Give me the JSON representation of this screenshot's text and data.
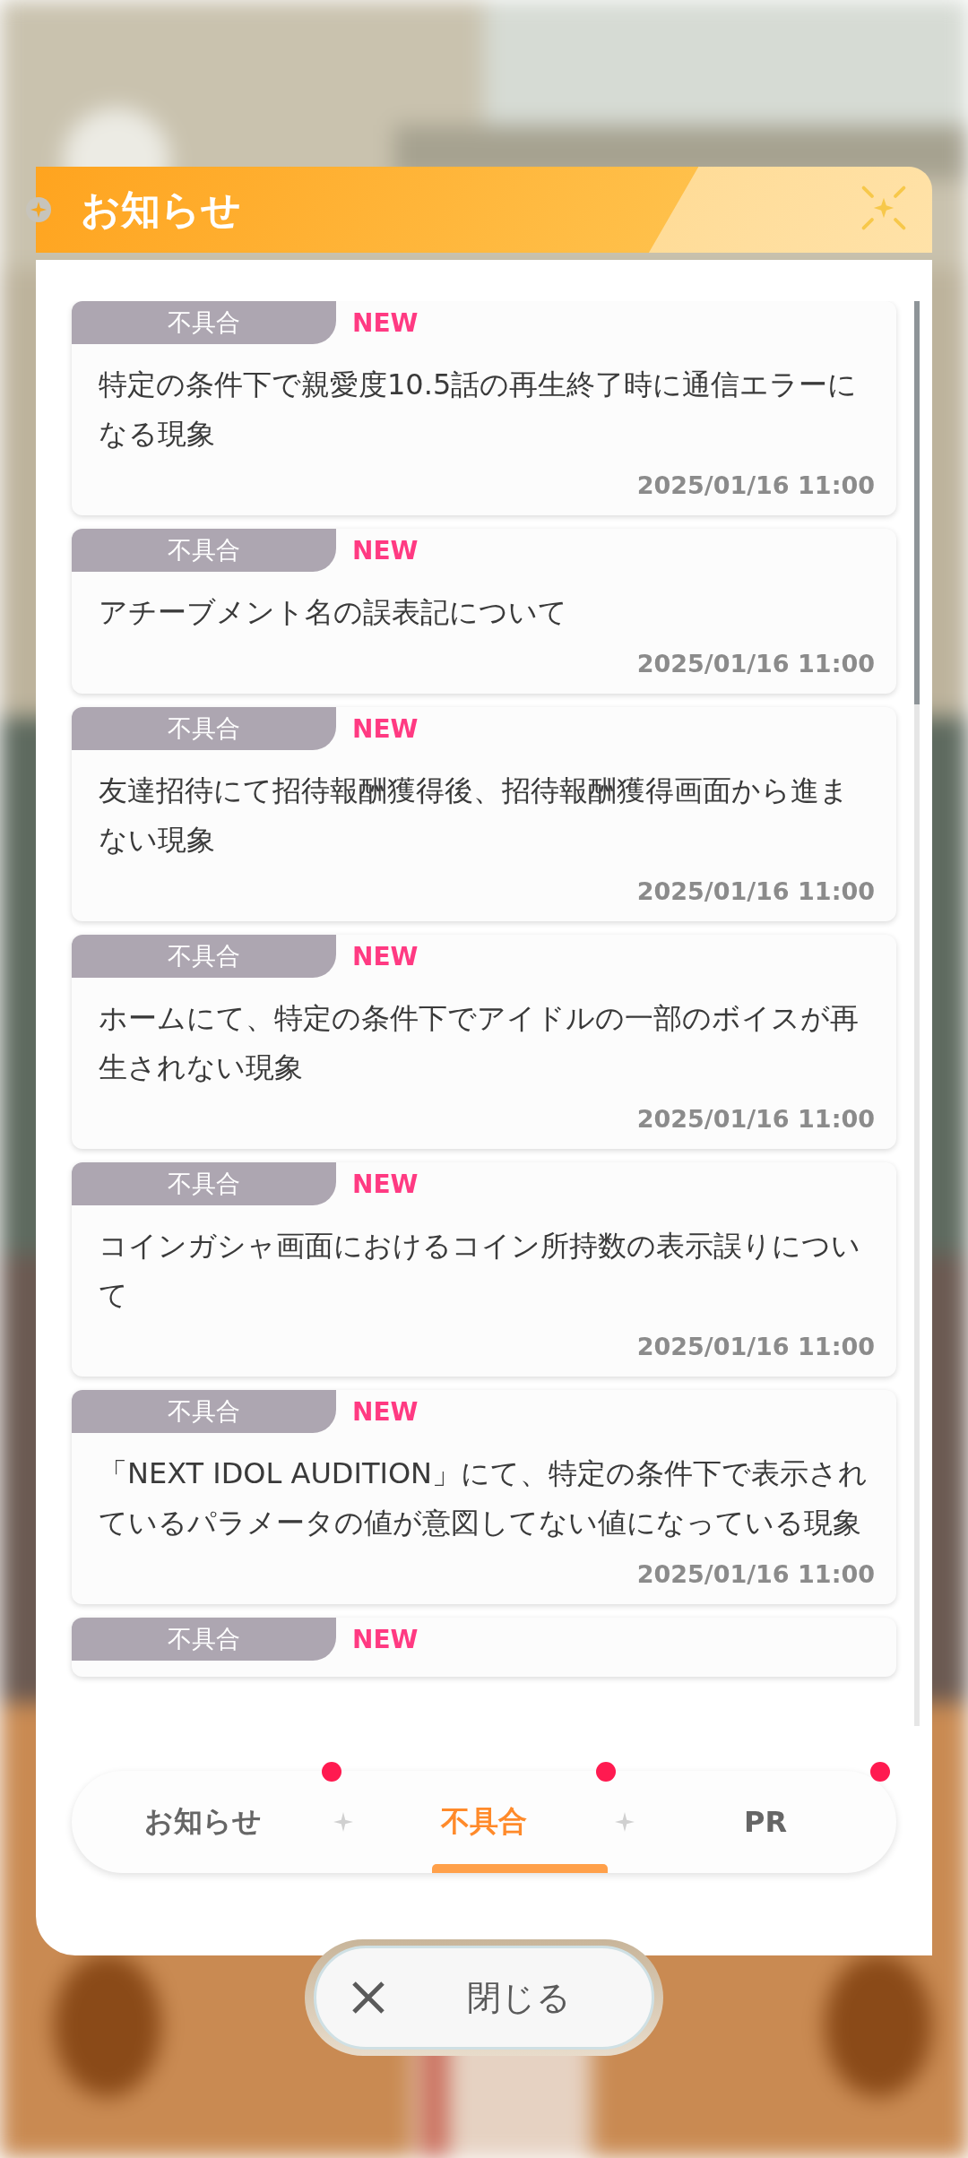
{
  "dialog": {
    "title": "お知らせ"
  },
  "notices": [
    {
      "category": "不具合",
      "new_label": "NEW",
      "title": "特定の条件下で親愛度10.5話の再生終了時に通信エラーになる現象",
      "date": "2025/01/16 11:00"
    },
    {
      "category": "不具合",
      "new_label": "NEW",
      "title": "アチーブメント名の誤表記について",
      "date": "2025/01/16 11:00"
    },
    {
      "category": "不具合",
      "new_label": "NEW",
      "title": "友達招待にて招待報酬獲得後、招待報酬獲得画面から進まない現象",
      "date": "2025/01/16 11:00"
    },
    {
      "category": "不具合",
      "new_label": "NEW",
      "title": "ホームにて、特定の条件下でアイドルの一部のボイスが再生されない現象",
      "date": "2025/01/16 11:00"
    },
    {
      "category": "不具合",
      "new_label": "NEW",
      "title": "コインガシャ画面におけるコイン所持数の表示誤りについて",
      "date": "2025/01/16 11:00"
    },
    {
      "category": "不具合",
      "new_label": "NEW",
      "title": "「NEXT IDOL AUDITION」にて、特定の条件下で表示されているパラメータの値が意図してない値になっている現象",
      "date": "2025/01/16 11:00"
    },
    {
      "category": "不具合",
      "new_label": "NEW"
    }
  ],
  "tabs": [
    {
      "label": "お知らせ",
      "selected": false,
      "unread": true
    },
    {
      "label": "不具合",
      "selected": true,
      "unread": true
    },
    {
      "label": "PR",
      "selected": false,
      "unread": true
    }
  ],
  "close_button": {
    "label": "閉じる"
  }
}
